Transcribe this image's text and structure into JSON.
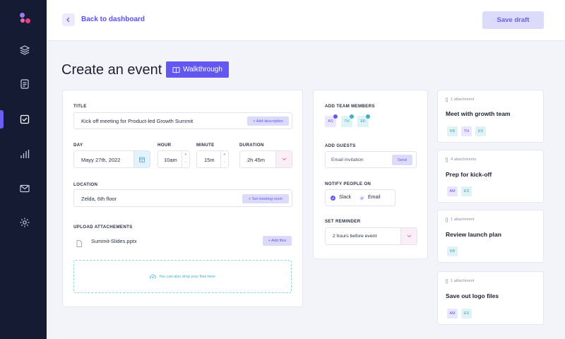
{
  "topbar": {
    "back_label": "Back to dashboard",
    "save_label": "Save draft"
  },
  "page": {
    "title": "Create an event",
    "walkthrough_label": "Walkthrough"
  },
  "sidebar": {
    "items": [
      {
        "name": "layers-icon",
        "active": false
      },
      {
        "name": "document-icon",
        "active": false
      },
      {
        "name": "checkbox-icon",
        "active": true
      },
      {
        "name": "chart-icon",
        "active": false
      },
      {
        "name": "mail-icon",
        "active": false
      },
      {
        "name": "gear-icon",
        "active": false
      }
    ]
  },
  "form": {
    "title_label": "TITLE",
    "title_value": "Kick off meeting for Product-led Growth Summit",
    "add_description": "+ Add description",
    "day_label": "DAY",
    "day_value": "Mayy 27th, 2022",
    "hour_label": "HOUR",
    "hour_value": "10am",
    "minute_label": "MINUTE",
    "minute_value": "15m",
    "duration_label": "DURATION",
    "duration_value": "2h 45m",
    "stepper_plus": "+",
    "stepper_minus": "-",
    "location_label": "LOCATION",
    "location_value": "Zelda, 6th floor",
    "set_room": "+ Set meeting room",
    "upload_label": "UPLOAD ATTACHEMENTS",
    "file_name": "Summit-Slides.pptx",
    "add_files": "+ Add files",
    "drop_text": "You can also drop your files here"
  },
  "team": {
    "members_label": "ADD TEAM MEMBERS",
    "members": [
      "AS",
      "TH",
      "EK"
    ],
    "guests_label": "ADD GUESTS",
    "guest_placeholder": "Email invitation",
    "send_label": "Send",
    "notify_label": "NOTIFY PEOPLE ON",
    "notify_options": [
      "Slack",
      "Email"
    ],
    "reminder_label": "SET REMINDER",
    "reminder_value": "2 hours before event"
  },
  "tasks": [
    {
      "attachments": "1 attachment",
      "title": "Meet with growth team",
      "avatars": [
        "KB",
        "TH",
        "ES"
      ]
    },
    {
      "attachments": "4 attachments",
      "title": "Prep for kick-off",
      "avatars": [
        "AM",
        "ES"
      ]
    },
    {
      "attachments": "1 attachment",
      "title": "Review launch plan",
      "avatars": [
        "KB"
      ]
    },
    {
      "attachments": "1 attachment",
      "title": "Save out logo files",
      "avatars": [
        "AM",
        "ES"
      ]
    }
  ],
  "colors": {
    "accent": "#6357f2",
    "sidebar": "#141b33",
    "teal": "#3fb0c1"
  }
}
